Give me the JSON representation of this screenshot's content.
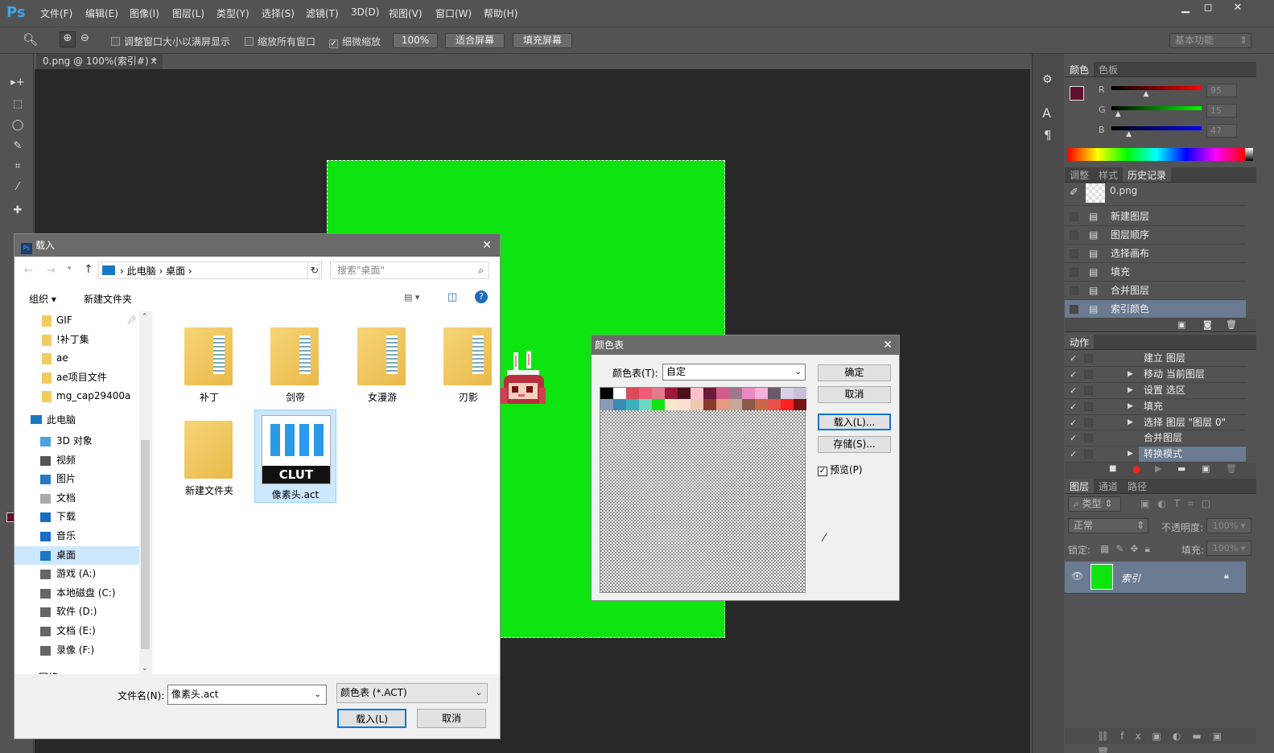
{
  "app": {
    "logo": "Ps"
  },
  "menu": [
    "文件(F)",
    "编辑(E)",
    "图像(I)",
    "图层(L)",
    "类型(Y)",
    "选择(S)",
    "滤镜(T)",
    "3D(D)",
    "视图(V)",
    "窗口(W)",
    "帮助(H)"
  ],
  "options": {
    "resize_windows": "调整窗口大小以满屏显示",
    "zoom_all": "缩放所有窗口",
    "scrubby_zoom": "细微缩放",
    "zoom_100": "100%",
    "fit_screen": "适合屏幕",
    "fill_screen": "填充屏幕",
    "workspace": "基本功能"
  },
  "doc_tab": {
    "title": "0.png @ 100%(索引#) *",
    "close": "×"
  },
  "color_panel": {
    "tabs": [
      "颜色",
      "色板"
    ],
    "channels": [
      {
        "label": "R",
        "value": "95"
      },
      {
        "label": "G",
        "value": "15"
      },
      {
        "label": "B",
        "value": "47"
      }
    ],
    "fg_color": "#5f0f2f"
  },
  "history_panel": {
    "tabs": [
      "调整",
      "样式",
      "历史记录"
    ],
    "snapshot": "0.png",
    "items": [
      "新建图层",
      "图层顺序",
      "选择画布",
      "填充",
      "合并图层",
      "索引颜色"
    ]
  },
  "actions_panel": {
    "tab": "动作",
    "items": [
      "建立 图层",
      "移动 当前图层",
      "设置 选区",
      "填充",
      "选择 图层 \"图层 0\"",
      "合并图层",
      "转换模式"
    ]
  },
  "layers_panel": {
    "tabs": [
      "图层",
      "通道",
      "路径"
    ],
    "filter": "类型",
    "blend": "正常",
    "opacity_label": "不透明度:",
    "opacity": "100%",
    "lock_label": "锁定:",
    "fill_label": "填充:",
    "fill": "100%",
    "layer_name": "索引"
  },
  "load_dialog": {
    "title": "载入",
    "breadcrumb": [
      "此电脑",
      "桌面"
    ],
    "search_placeholder": "搜索\"桌面\"",
    "organize": "组织 ▾",
    "new_folder": "新建文件夹",
    "nav_quick": [
      "GIF",
      "!补丁集",
      "ae",
      "ae项目文件",
      "mg_cap29400a"
    ],
    "nav_pc": "此电脑",
    "nav_items": [
      "3D 对象",
      "视频",
      "图片",
      "文档",
      "下载",
      "音乐",
      "桌面",
      "游戏 (A:)",
      "本地磁盘 (C:)",
      "软件 (D:)",
      "文档 (E:)",
      "录像 (F:)"
    ],
    "nav_more": "网络",
    "files": [
      "补丁",
      "剑帝",
      "女漫游",
      "刃影",
      "新建文件夹",
      "像素头.act"
    ],
    "clut_label": "CLUT",
    "filename_label": "文件名(N):",
    "filename": "像素头.act",
    "filetype": "颜色表 (*.ACT)",
    "load_btn": "载入(L)",
    "cancel_btn": "取消"
  },
  "color_table_dialog": {
    "title": "颜色表",
    "table_label": "颜色表(T):",
    "table_value": "自定",
    "ok": "确定",
    "cancel": "取消",
    "load": "载入(L)...",
    "save": "存储(S)...",
    "preview": "预览(P)",
    "colors": [
      "#000000",
      "#ffffff",
      "#d94b5b",
      "#f05c75",
      "#e07a8c",
      "#9b1a3a",
      "#4a1020",
      "#ffc0cb",
      "#6b1a3a",
      "#d15c8a",
      "#9a7a8a",
      "#e98ac0",
      "#f4b0d8",
      "#6a5a6a",
      "#d8d0e8",
      "#c8c0d8",
      "#8a9ab8",
      "#3a8ab8",
      "#3ab0b8",
      "#6ad8c0",
      "#0ee510",
      "#f4e8c8",
      "#f8e0d0",
      "#f0c8b0",
      "#8a3a2a",
      "#e89a80",
      "#c8a898",
      "#8a5a4a",
      "#c8684a",
      "#e8504a",
      "#ff2020",
      "#7a1010"
    ]
  }
}
